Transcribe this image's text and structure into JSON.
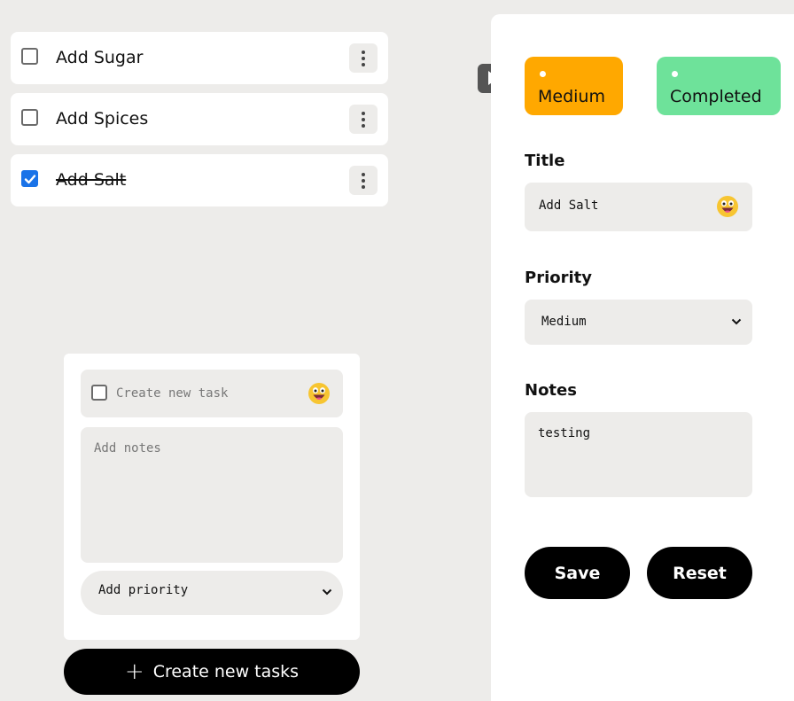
{
  "tasks": [
    {
      "label": "Add Sugar",
      "completed": false
    },
    {
      "label": "Add Spices",
      "completed": false
    },
    {
      "label": "Add Salt",
      "completed": true
    }
  ],
  "create_form": {
    "task_placeholder": "Create new task",
    "notes_placeholder": "Add notes",
    "priority_value": "Add priority",
    "emoji_icon": "grinning-face-emoji",
    "create_button_label": "Create new tasks",
    "create_button_icon": "plus-icon"
  },
  "detail": {
    "tags": [
      {
        "label": "Medium",
        "color": "#ffa800"
      },
      {
        "label": "Completed",
        "color": "#6ee29a"
      }
    ],
    "title_label": "Title",
    "title_value": "Add Salt",
    "priority_label": "Priority",
    "priority_value": "Medium",
    "notes_label": "Notes",
    "notes_value": "testing",
    "save_label": "Save",
    "reset_label": "Reset"
  }
}
